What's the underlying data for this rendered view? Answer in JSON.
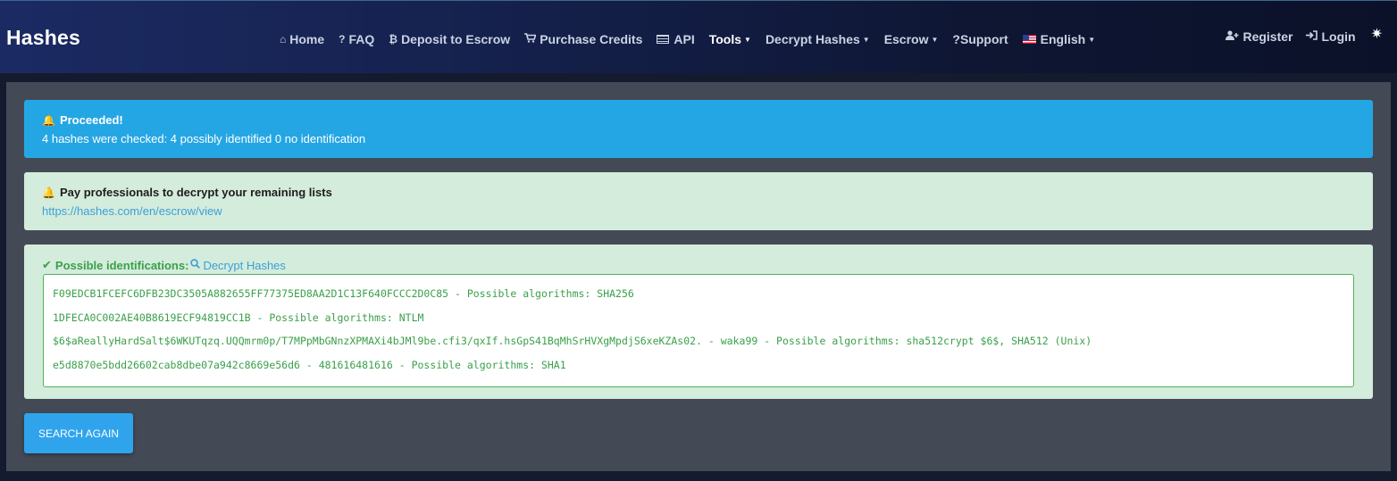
{
  "brand": "Hashes",
  "nav": {
    "home": "Home",
    "faq": "FAQ",
    "deposit": "Deposit to Escrow",
    "purchase": "Purchase Credits",
    "api": "API",
    "tools": "Tools",
    "decrypt": "Decrypt Hashes",
    "escrow": "Escrow",
    "support": "?Support",
    "language": "English"
  },
  "nav_right": {
    "register": "Register",
    "login": "Login"
  },
  "alert_info": {
    "title": "Proceeded!",
    "text": "4 hashes were checked: 4 possibly identified 0 no identification"
  },
  "alert_escrow": {
    "title": "Pay professionals to decrypt your remaining lists",
    "link": "https://hashes.com/en/escrow/view"
  },
  "results": {
    "label": "Possible identifications:",
    "decrypt_link": "Decrypt Hashes",
    "lines": [
      "F09EDCB1FCEFC6DFB23DC3505A882655FF77375ED8AA2D1C13F640FCCC2D0C85 - Possible algorithms: SHA256",
      "1DFECA0C002AE40B8619ECF94819CC1B - Possible algorithms: NTLM",
      "$6$aReallyHardSalt$6WKUTqzq.UQQmrm0p/T7MPpMbGNnzXPMAXi4bJMl9be.cfi3/qxIf.hsGpS41BqMhSrHVXgMpdjS6xeKZAs02. - waka99 - Possible algorithms: sha512crypt $6$, SHA512 (Unix)",
      "e5d8870e5bdd26602cab8dbe07a942c8669e56d6 - 481616481616 - Possible algorithms: SHA1"
    ]
  },
  "search_button": "SEARCH AGAIN",
  "colors": {
    "info": "#25a6e4",
    "success_bg": "#d4ecdc",
    "success_text": "#3aa04a",
    "link": "#3aa0d6",
    "panel": "#434a55"
  },
  "icons": {
    "home": "home-icon",
    "faq": "question-icon",
    "deposit": "bitcoin-icon",
    "purchase": "cart-icon",
    "api": "api-icon",
    "register": "user-plus-icon",
    "login": "sign-in-icon",
    "settings": "gear-icon",
    "alert": "bell-icon",
    "success": "check-icon",
    "search": "search-icon"
  }
}
